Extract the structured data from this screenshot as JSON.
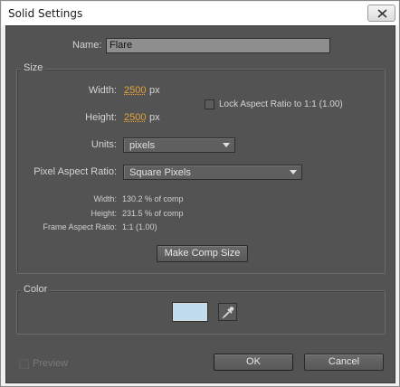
{
  "window": {
    "title": "Solid Settings",
    "close_icon": "close-icon"
  },
  "name": {
    "label": "Name:",
    "value": "Flare"
  },
  "size": {
    "group_title": "Size",
    "width_label": "Width:",
    "width_value": "2500",
    "width_unit": "px",
    "height_label": "Height:",
    "height_value": "2500",
    "height_unit": "px",
    "lock_label": "Lock Aspect Ratio to 1:1 (1.00)",
    "lock_checked": false,
    "units_label": "Units:",
    "units_value": "pixels",
    "par_label": "Pixel Aspect Ratio:",
    "par_value": "Square Pixels",
    "info": {
      "width_label": "Width:",
      "width_value": "130.2 % of comp",
      "height_label": "Height:",
      "height_value": "231.5 % of comp",
      "far_label": "Frame Aspect Ratio:",
      "far_value": "1:1 (1.00)"
    },
    "make_comp_size": "Make Comp Size"
  },
  "color": {
    "group_title": "Color",
    "swatch_color": "#c0dcee",
    "picker_icon": "eyedropper-icon"
  },
  "footer": {
    "preview_label": "Preview",
    "ok_label": "OK",
    "cancel_label": "Cancel"
  }
}
